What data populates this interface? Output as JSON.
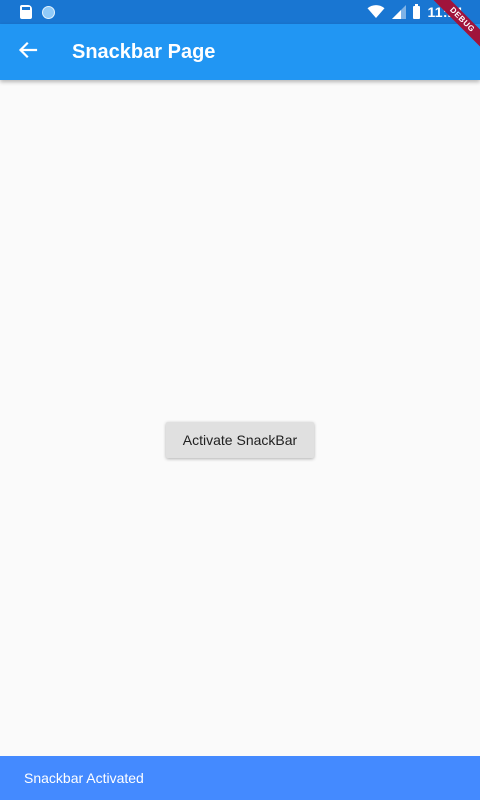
{
  "status_bar": {
    "time": "11:21",
    "left_icons": [
      "sd-card-icon",
      "sync-icon"
    ],
    "right_icons": [
      "wifi-icon",
      "cell-signal-icon",
      "battery-icon"
    ]
  },
  "debug_banner": {
    "label": "DEBUG"
  },
  "app_bar": {
    "title": "Snackbar Page",
    "back_icon": "arrow-back-icon"
  },
  "main": {
    "button_label": "Activate SnackBar"
  },
  "snackbar": {
    "message": "Snackbar Activated"
  },
  "colors": {
    "status_bar": "#1976d2",
    "app_bar": "#2196f3",
    "background": "#fafafa",
    "button": "#e0e0e0",
    "snackbar": "#448aff",
    "debug_banner": "#a0143c"
  }
}
